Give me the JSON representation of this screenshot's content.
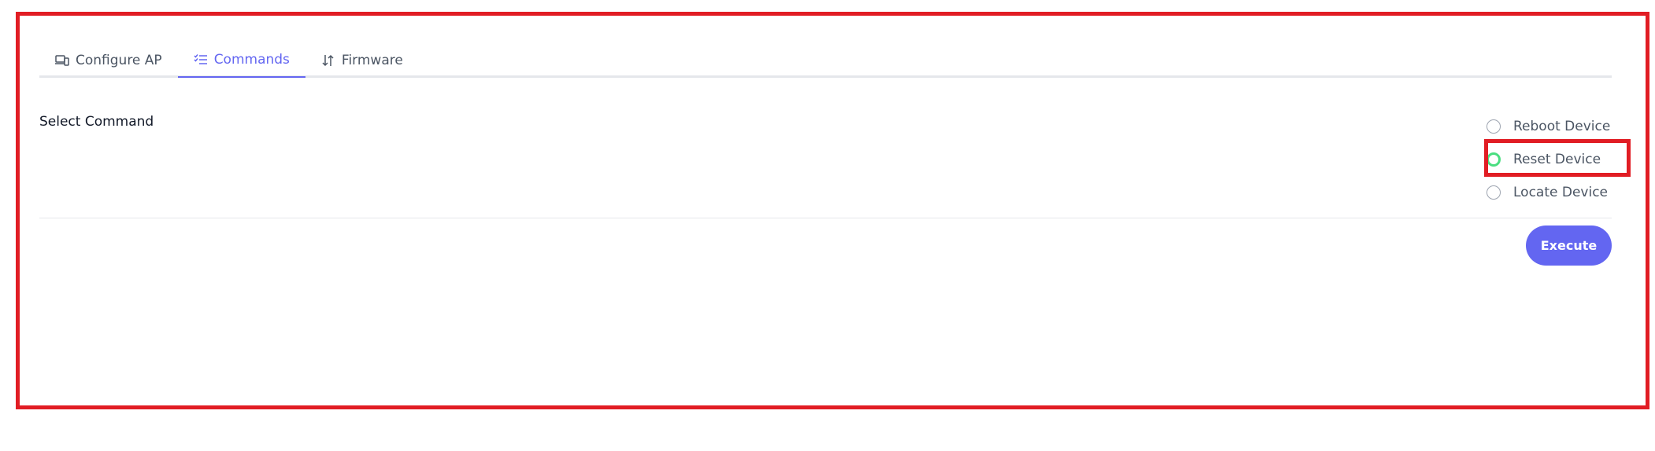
{
  "tabs": [
    {
      "label": "Configure AP",
      "icon": "devices-icon",
      "active": false
    },
    {
      "label": "Commands",
      "icon": "checklist-icon",
      "active": true
    },
    {
      "label": "Firmware",
      "icon": "sort-arrows-icon",
      "active": false
    }
  ],
  "commands": {
    "label": "Select Command",
    "options": [
      {
        "label": "Reboot Device",
        "selected": false
      },
      {
        "label": "Reset Device",
        "selected": true
      },
      {
        "label": "Locate Device",
        "selected": false
      }
    ]
  },
  "execute_label": "Execute",
  "colors": {
    "accent": "#6366f1",
    "selected_radio": "#4ade80",
    "highlight": "#e11d24"
  }
}
